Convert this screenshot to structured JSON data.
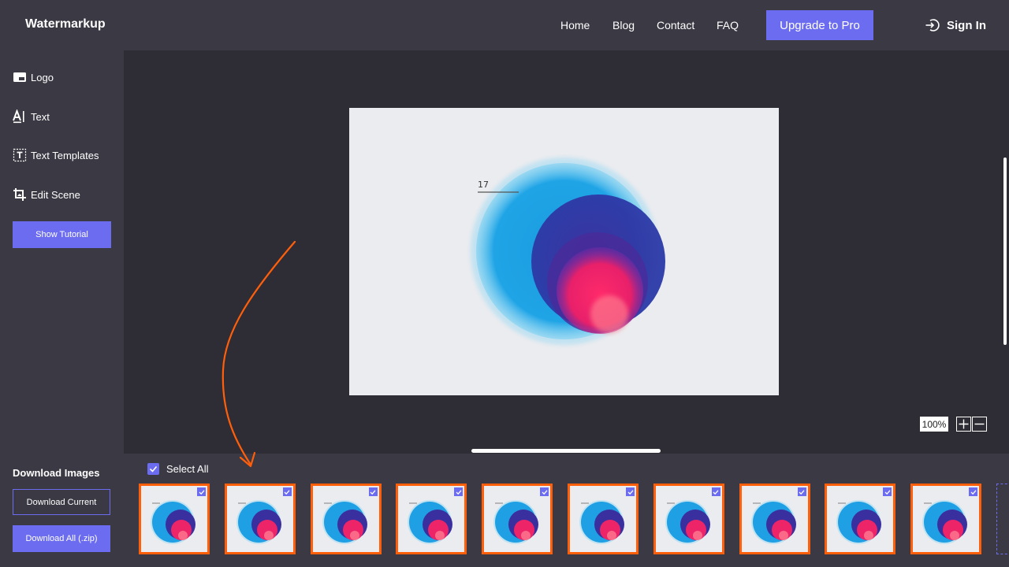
{
  "header": {
    "brand": "Watermarkup",
    "nav": [
      "Home",
      "Blog",
      "Contact",
      "FAQ"
    ],
    "upgrade": "Upgrade to Pro",
    "sign_in": "Sign In"
  },
  "sidebar": {
    "items": [
      {
        "label": "Logo",
        "icon": "logo-icon"
      },
      {
        "label": "Text",
        "icon": "text-icon"
      },
      {
        "label": "Text Templates",
        "icon": "text-template-icon"
      },
      {
        "label": "Edit Scene",
        "icon": "crop-icon"
      }
    ],
    "tutorial": "Show Tutorial",
    "download_title": "Download Images",
    "download_current": "Download Current",
    "download_all": "Download All (.zip)"
  },
  "canvas": {
    "image_number": "17",
    "zoom": "100%"
  },
  "gallery": {
    "select_all": "Select All",
    "thumb_count": 10
  },
  "colors": {
    "accent": "#6c6cf0",
    "highlight": "#ff5f0a",
    "panel": "#3a3944",
    "background": "#2e2d35"
  }
}
